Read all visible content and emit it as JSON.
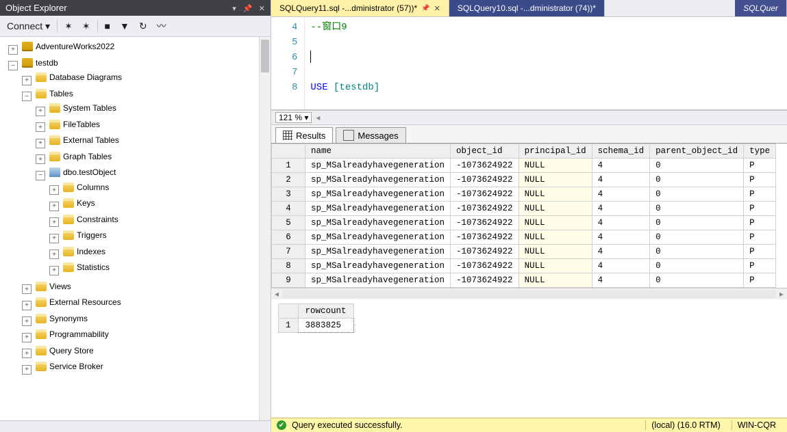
{
  "panel": {
    "title": "Object Explorer",
    "connect_label": "Connect"
  },
  "tree": {
    "db1": "AdventureWorks2022",
    "db2": "testdb",
    "diagrams": "Database Diagrams",
    "tables": "Tables",
    "systables": "System Tables",
    "filetables": "FileTables",
    "exttables": "External Tables",
    "graphtables": "Graph Tables",
    "testobject": "dbo.testObject",
    "columns": "Columns",
    "keys": "Keys",
    "constraints": "Constraints",
    "triggers": "Triggers",
    "indexes": "Indexes",
    "statistics": "Statistics",
    "views": "Views",
    "extres": "External Resources",
    "synonyms": "Synonyms",
    "program": "Programmability",
    "qstore": "Query Store",
    "sbroker": "Service Broker"
  },
  "tabs": {
    "active": "SQLQuery11.sql -...dministrator (57))*",
    "other": "SQLQuery10.sql -...dministrator (74))*",
    "far": "SQLQuer"
  },
  "editor": {
    "lines": {
      "4": "--窗口9",
      "5": "",
      "6": "",
      "7": "",
      "8_kw": "USE ",
      "8_id": "[testdb]"
    },
    "gutter": [
      "4",
      "5",
      "6",
      "7",
      "8"
    ]
  },
  "zoom": "121 %",
  "result_tabs": {
    "results": "Results",
    "messages": "Messages"
  },
  "columns": [
    "name",
    "object_id",
    "principal_id",
    "schema_id",
    "parent_object_id",
    "type"
  ],
  "rows": [
    {
      "n": "1",
      "name": "sp_MSalreadyhavegeneration",
      "object_id": "-1073624922",
      "principal_id": "NULL",
      "schema_id": "4",
      "parent_object_id": "0",
      "type": "P"
    },
    {
      "n": "2",
      "name": "sp_MSalreadyhavegeneration",
      "object_id": "-1073624922",
      "principal_id": "NULL",
      "schema_id": "4",
      "parent_object_id": "0",
      "type": "P"
    },
    {
      "n": "3",
      "name": "sp_MSalreadyhavegeneration",
      "object_id": "-1073624922",
      "principal_id": "NULL",
      "schema_id": "4",
      "parent_object_id": "0",
      "type": "P"
    },
    {
      "n": "4",
      "name": "sp_MSalreadyhavegeneration",
      "object_id": "-1073624922",
      "principal_id": "NULL",
      "schema_id": "4",
      "parent_object_id": "0",
      "type": "P"
    },
    {
      "n": "5",
      "name": "sp_MSalreadyhavegeneration",
      "object_id": "-1073624922",
      "principal_id": "NULL",
      "schema_id": "4",
      "parent_object_id": "0",
      "type": "P"
    },
    {
      "n": "6",
      "name": "sp_MSalreadyhavegeneration",
      "object_id": "-1073624922",
      "principal_id": "NULL",
      "schema_id": "4",
      "parent_object_id": "0",
      "type": "P"
    },
    {
      "n": "7",
      "name": "sp_MSalreadyhavegeneration",
      "object_id": "-1073624922",
      "principal_id": "NULL",
      "schema_id": "4",
      "parent_object_id": "0",
      "type": "P"
    },
    {
      "n": "8",
      "name": "sp_MSalreadyhavegeneration",
      "object_id": "-1073624922",
      "principal_id": "NULL",
      "schema_id": "4",
      "parent_object_id": "0",
      "type": "P"
    },
    {
      "n": "9",
      "name": "sp_MSalreadyhavegeneration",
      "object_id": "-1073624922",
      "principal_id": "NULL",
      "schema_id": "4",
      "parent_object_id": "0",
      "type": "P"
    }
  ],
  "rowcount": {
    "header": "rowcount",
    "rownum": "1",
    "value": "3883825"
  },
  "status": {
    "msg": "Query executed successfully.",
    "server": "(local) (16.0 RTM)",
    "user": "WIN-CQR"
  }
}
